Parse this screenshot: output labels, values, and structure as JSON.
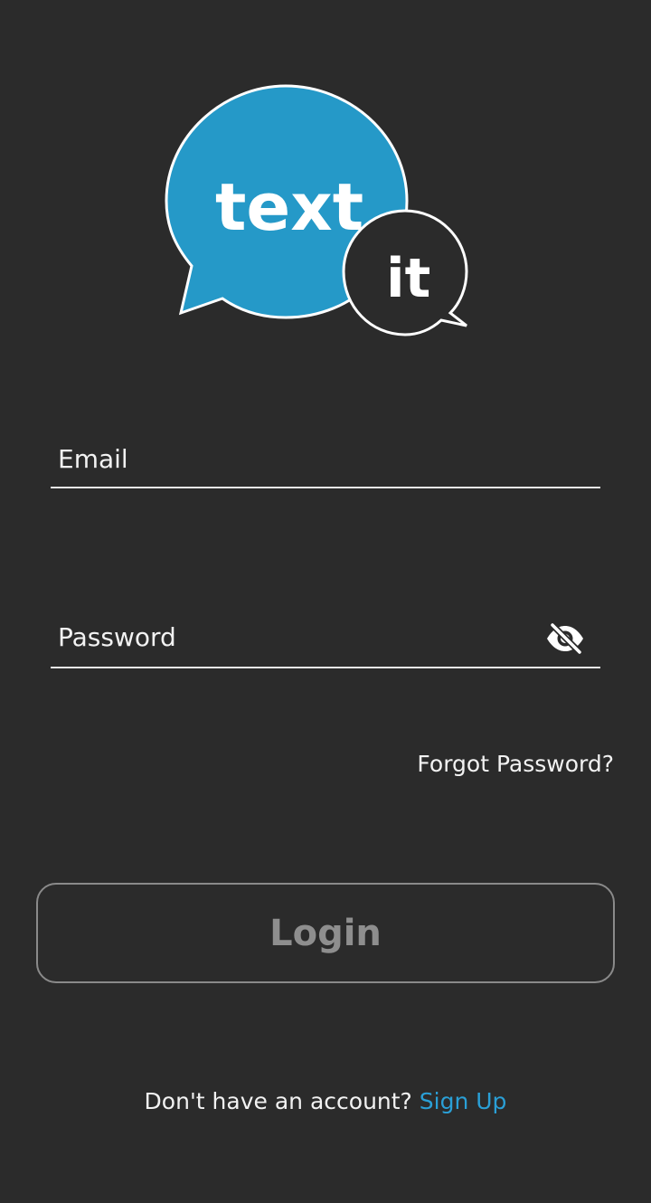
{
  "logo": {
    "main_text": "text",
    "sub_text": "it",
    "bubble_color": "#2599c8",
    "small_bubble_color": "#2b2b2b"
  },
  "email": {
    "placeholder": "Email",
    "value": ""
  },
  "password": {
    "placeholder": "Password",
    "value": "",
    "toggle_icon": "eye-off-icon"
  },
  "forgot_password": "Forgot Password?",
  "login_button": "Login",
  "signup": {
    "prompt": "Don't have an account?",
    "link": "Sign Up",
    "link_color": "#2a9fd6"
  }
}
